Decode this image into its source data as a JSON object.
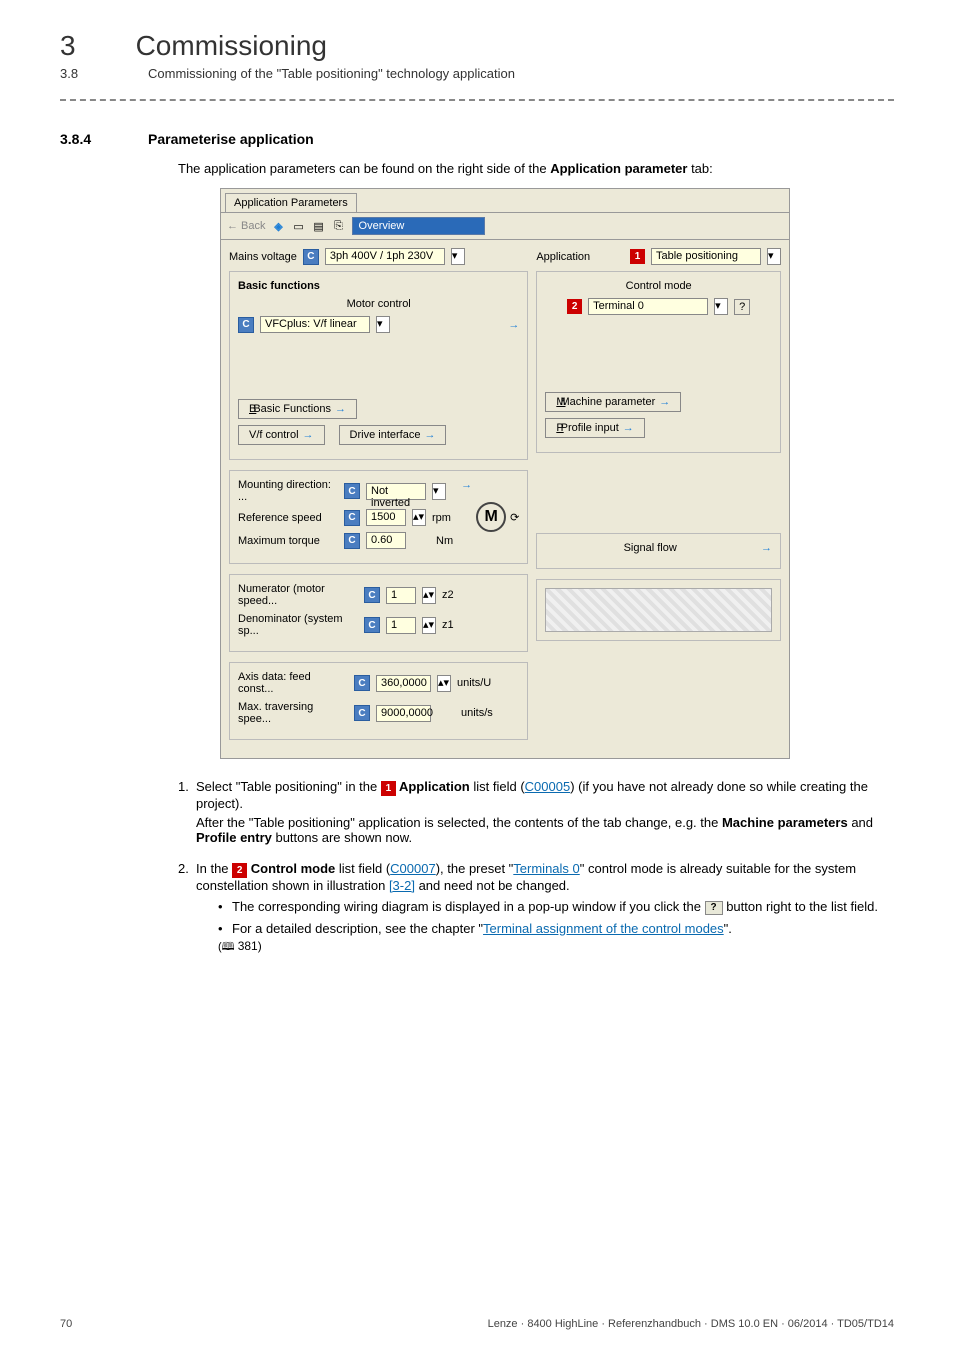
{
  "header": {
    "chapter_num": "3",
    "chapter_title": "Commissioning",
    "sub_num": "3.8",
    "sub_title": "Commissioning of the \"Table positioning\" technology application"
  },
  "section": {
    "num": "3.8.4",
    "title": "Parameterise application",
    "intro_prefix": "The application parameters can be found on the right side of the ",
    "intro_bold": "Application parameter",
    "intro_suffix": " tab:"
  },
  "screenshot": {
    "tab": "Application Parameters",
    "toolbar": {
      "back": "← Back",
      "overview": "Overview"
    },
    "mains_label": "Mains voltage",
    "mains_value": "3ph 400V / 1ph 230V",
    "application_label": "Application",
    "application_value": "Table positioning",
    "basic_group": "Basic functions",
    "motor_control_label": "Motor control",
    "motor_control_value": "VFCplus: V/f linear",
    "control_mode_label": "Control mode",
    "control_mode_value": "Terminal 0",
    "btn_basic": "Basic Functions",
    "btn_vf": "V/f control",
    "btn_drive": "Drive interface",
    "btn_machine": "Machine parameter",
    "btn_profile": "Profile input",
    "mounting_label": "Mounting direction: ...",
    "mounting_value": "Not inverted",
    "refspeed_label": "Reference speed",
    "refspeed_value": "1500",
    "refspeed_unit": "rpm",
    "maxtorque_label": "Maximum torque",
    "maxtorque_value": "0.60",
    "maxtorque_unit": "Nm",
    "motor_icon": "M",
    "numerator_label": "Numerator (motor speed...",
    "numerator_value": "1",
    "numerator_gear": "z2",
    "denominator_label": "Denominator (system sp...",
    "denominator_value": "1",
    "denominator_gear": "z1",
    "signalflow_label": "Signal flow",
    "feed_label": "Axis data: feed const...",
    "feed_value": "360,0000",
    "feed_unit": "units/U",
    "traverse_label": "Max. traversing spee...",
    "traverse_value": "9000,0000",
    "traverse_unit": "units/s",
    "badge1": "1",
    "badge2": "2",
    "help_btn": "?",
    "c_btn": "C"
  },
  "steps": {
    "s1_num": "1.",
    "s1_a": "Select \"Table positioning\" in the ",
    "s1_badge": "1",
    "s1_b": " Application",
    "s1_c": " list field (",
    "s1_link": "C00005",
    "s1_d": ") (if you have not already done so while creating the project).",
    "s1_e": "After the \"Table positioning\" application is selected, the contents of the tab change, e.g. the ",
    "s1_f": "Machine parameters",
    "s1_g": " and ",
    "s1_h": "Profile entry",
    "s1_i": " buttons are shown now.",
    "s2_num": "2.",
    "s2_a": "In the ",
    "s2_badge": "2",
    "s2_b": " Control mode",
    "s2_c": " list field (",
    "s2_link1": "C00007",
    "s2_d": "), the preset \"",
    "s2_link2": "Terminals 0",
    "s2_e": "\" control mode is already suitable for the system constellation shown in illustration ",
    "s2_link3": "[3-2]",
    "s2_f": " and need not be changed.",
    "s2_bullet1a": "The corresponding wiring diagram is displayed in a pop-up window if you click the ",
    "s2_bullet1_q": "?",
    "s2_bullet1b": " button right to the list field.",
    "s2_bullet2a": "For a detailed description, see the chapter \"",
    "s2_bullet2_link": "Terminal assignment of the control modes",
    "s2_bullet2b": "\".",
    "s2_pageref": "381"
  },
  "footer": {
    "page": "70",
    "meta": "Lenze · 8400 HighLine · Referenzhandbuch · DMS 10.0 EN · 06/2014 · TD05/TD14"
  }
}
